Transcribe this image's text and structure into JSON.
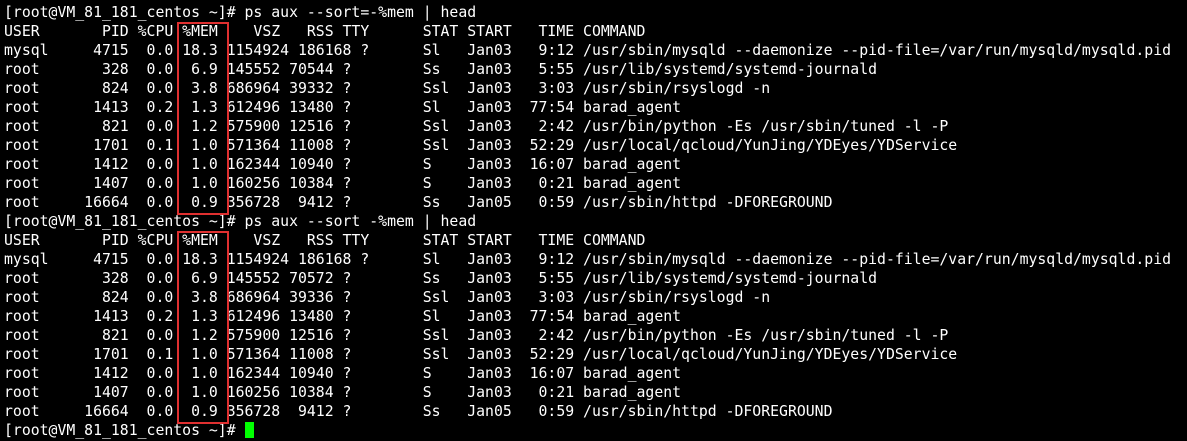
{
  "terminal": {
    "lines": [
      "[root@VM_81_181_centos ~]# ps aux --sort=-%mem | head",
      "USER       PID %CPU %MEM    VSZ   RSS TTY      STAT START   TIME COMMAND",
      "mysql     4715  0.0 18.3 1154924 186168 ?      Sl   Jan03   9:12 /usr/sbin/mysqld --daemonize --pid-file=/var/run/mysqld/mysqld.pid",
      "root       328  0.0  6.9 145552 70544 ?        Ss   Jan03   5:55 /usr/lib/systemd/systemd-journald",
      "root       824  0.0  3.8 686964 39332 ?        Ssl  Jan03   3:03 /usr/sbin/rsyslogd -n",
      "root      1413  0.2  1.3 612496 13480 ?        Sl   Jan03  77:54 barad_agent",
      "root       821  0.0  1.2 575900 12516 ?        Ssl  Jan03   2:42 /usr/bin/python -Es /usr/sbin/tuned -l -P",
      "root      1701  0.1  1.0 571364 11008 ?        Ssl  Jan03  52:29 /usr/local/qcloud/YunJing/YDEyes/YDService",
      "root      1412  0.0  1.0 162344 10940 ?        S    Jan03  16:07 barad_agent",
      "root      1407  0.0  1.0 160256 10384 ?        S    Jan03   0:21 barad_agent",
      "root     16664  0.0  0.9 356728  9412 ?        Ss   Jan05   0:59 /usr/sbin/httpd -DFOREGROUND",
      "[root@VM_81_181_centos ~]# ps aux --sort -%mem | head",
      "USER       PID %CPU %MEM    VSZ   RSS TTY      STAT START   TIME COMMAND",
      "mysql     4715  0.0 18.3 1154924 186168 ?      Sl   Jan03   9:12 /usr/sbin/mysqld --daemonize --pid-file=/var/run/mysqld/mysqld.pid",
      "root       328  0.0  6.9 145552 70572 ?        Ss   Jan03   5:55 /usr/lib/systemd/systemd-journald",
      "root       824  0.0  3.8 686964 39336 ?        Ssl  Jan03   3:03 /usr/sbin/rsyslogd -n",
      "root      1413  0.2  1.3 612496 13480 ?        Sl   Jan03  77:54 barad_agent",
      "root       821  0.0  1.2 575900 12516 ?        Ssl  Jan03   2:42 /usr/bin/python -Es /usr/sbin/tuned -l -P",
      "root      1701  0.1  1.0 571364 11008 ?        Ssl  Jan03  52:29 /usr/local/qcloud/YunJing/YDEyes/YDService",
      "root      1412  0.0  1.0 162344 10940 ?        S    Jan03  16:07 barad_agent",
      "root      1407  0.0  1.0 160256 10384 ?        S    Jan03   0:21 barad_agent",
      "root     16664  0.0  0.9 356728  9412 ?        Ss   Jan05   0:59 /usr/sbin/httpd -DFOREGROUND"
    ],
    "prompt": "[root@VM_81_181_centos ~]# ",
    "colors": {
      "background": "#000000",
      "foreground": "#ffffff",
      "cursor": "#00ff00",
      "highlight": "#e03030"
    }
  }
}
